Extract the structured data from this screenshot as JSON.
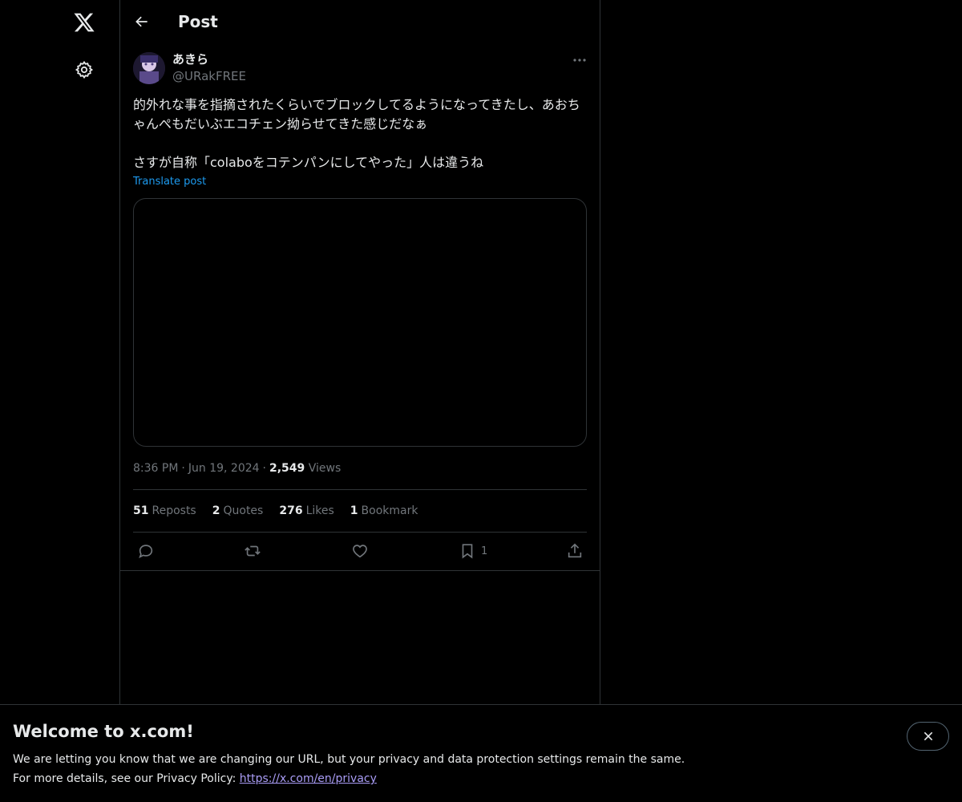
{
  "nav": {
    "logo_icon": "x-logo-icon",
    "settings_icon": "gear-icon"
  },
  "header": {
    "title": "Post",
    "back_icon": "arrow-left-icon"
  },
  "post": {
    "author_name": "あきら",
    "author_handle": "@URakFREE",
    "text": "的外れな事を指摘されたくらいでブロックしてるようになってきたし、あおちゃんぺもだいぶエコチェン拗らせてきた感じだなぁ\n\nさすが自称「colaboをコテンパンにしてやった」人は違うね",
    "translate_label": "Translate post",
    "time": "8:36 PM",
    "date": "Jun 19, 2024",
    "views_count": "2,549",
    "views_label": "Views",
    "separator": "·"
  },
  "stats": {
    "reposts_count": "51",
    "reposts_label": "Reposts",
    "quotes_count": "2",
    "quotes_label": "Quotes",
    "likes_count": "276",
    "likes_label": "Likes",
    "bookmarks_count": "1",
    "bookmarks_label": "Bookmark"
  },
  "actions": {
    "bookmark_count": "1",
    "icons": [
      "reply-icon",
      "repost-icon",
      "like-icon",
      "bookmark-icon",
      "share-icon"
    ]
  },
  "banner": {
    "title": "Welcome to x.com!",
    "line1": "We are letting you know that we are changing our URL, but your privacy and data protection settings remain the same.",
    "line2_prefix": "For more details, see our Privacy Policy: ",
    "link_text": "https://x.com/en/privacy",
    "close_icon": "close-icon"
  },
  "colors": {
    "background": "#000000",
    "text": "#e7e9ea",
    "secondary": "#71767b",
    "accent": "#1d9bf0",
    "border": "#2f3336",
    "link_visited": "#a99cf5"
  }
}
